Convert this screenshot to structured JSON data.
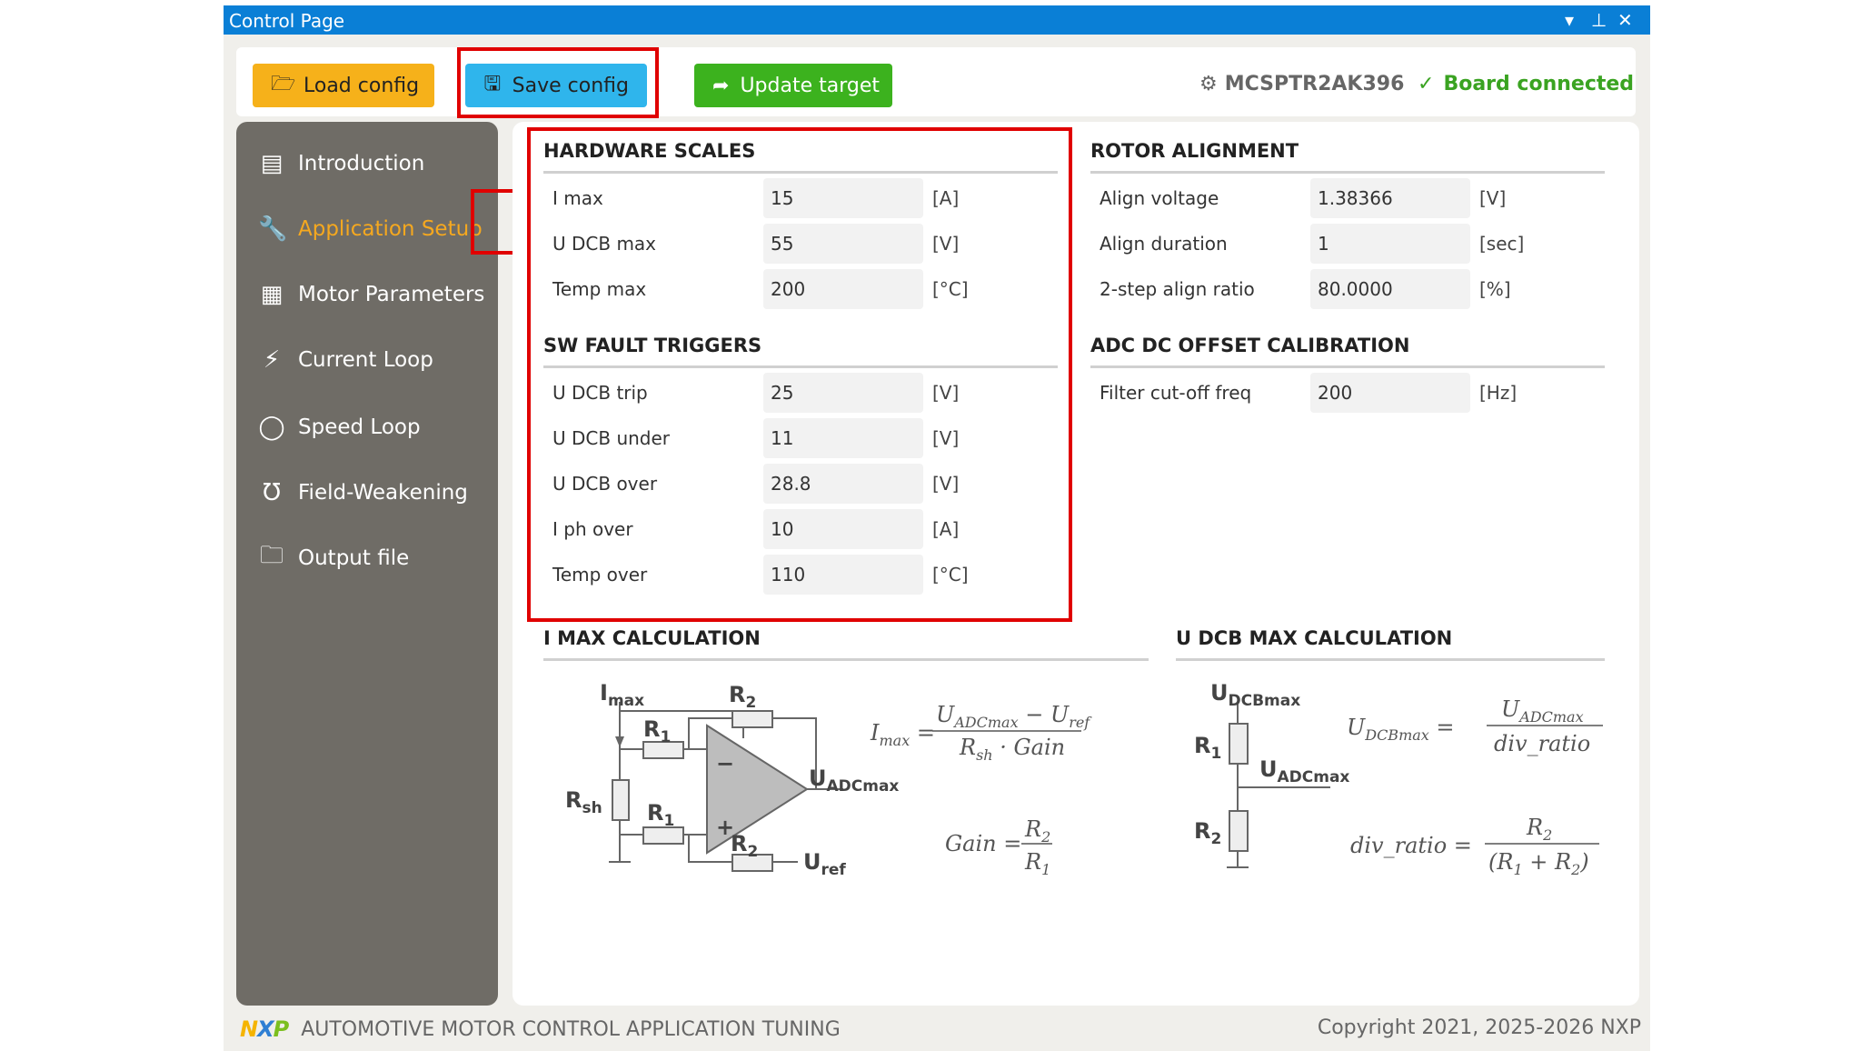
{
  "window": {
    "title": "Control Page",
    "controls": {
      "menu": "▾",
      "pin": "⊥",
      "close": "✕"
    }
  },
  "toolbar": {
    "load_label": "Load config",
    "save_label": "Save config",
    "update_label": "Update target",
    "board_id": "MCSPTR2AK396",
    "board_status": "Board connected",
    "colors": {
      "load": "#f6b11a",
      "save": "#2fb5ec",
      "update": "#3cb21e",
      "status": "#3aa321"
    }
  },
  "sidebar": {
    "items": [
      {
        "label": "Introduction",
        "icon": "book-icon"
      },
      {
        "label": "Application Setup",
        "icon": "wrench-icon",
        "active": true
      },
      {
        "label": "Motor Parameters",
        "icon": "calculator-icon"
      },
      {
        "label": "Current Loop",
        "icon": "lightning-icon"
      },
      {
        "label": "Speed Loop",
        "icon": "circle-icon"
      },
      {
        "label": "Field-Weakening",
        "icon": "magnet-icon"
      },
      {
        "label": "Output file",
        "icon": "folder-icon"
      }
    ],
    "active_color": "#f5a81f"
  },
  "hardware_scales": {
    "title": "HARDWARE SCALES",
    "rows": [
      {
        "label": "I max",
        "value": "15",
        "unit": "[A]"
      },
      {
        "label": "U DCB max",
        "value": "55",
        "unit": "[V]"
      },
      {
        "label": "Temp max",
        "value": "200",
        "unit": "[°C]"
      }
    ]
  },
  "sw_fault_triggers": {
    "title": "SW FAULT TRIGGERS",
    "rows": [
      {
        "label": "U DCB trip",
        "value": "25",
        "unit": "[V]"
      },
      {
        "label": "U DCB under",
        "value": "11",
        "unit": "[V]"
      },
      {
        "label": "U DCB over",
        "value": "28.8",
        "unit": "[V]"
      },
      {
        "label": "I ph over",
        "value": "10",
        "unit": "[A]"
      },
      {
        "label": "Temp over",
        "value": "110",
        "unit": "[°C]"
      }
    ]
  },
  "rotor_alignment": {
    "title": "ROTOR ALIGNMENT",
    "rows": [
      {
        "label": "Align voltage",
        "value": "1.38366",
        "unit": "[V]"
      },
      {
        "label": "Align duration",
        "value": "1",
        "unit": "[sec]"
      },
      {
        "label": "2-step align ratio",
        "value": "80.0000",
        "unit": "[%]"
      }
    ]
  },
  "adc_offset": {
    "title": "ADC DC OFFSET CALIBRATION",
    "rows": [
      {
        "label": "Filter cut-off freq",
        "value": "200",
        "unit": "[Hz]"
      }
    ]
  },
  "imax_calc": {
    "title": "I MAX CALCULATION",
    "labels": {
      "imax": "I",
      "imax_sub": "max",
      "r1": "R",
      "r1_sub": "1",
      "r2": "R",
      "r2_sub": "2",
      "rsh": "R",
      "rsh_sub": "sh",
      "uadc": "U",
      "uadc_sub": "ADCmax",
      "uref": "U",
      "uref_sub": "ref",
      "minus": "−",
      "plus": "+"
    },
    "eq1": {
      "lhs": "I",
      "lhs_sub": "max",
      "num": "U",
      "num_sub": "ADCmax",
      "num_op": " − U",
      "num_sub2": "ref",
      "den": "R",
      "den_sub": "sh",
      "den_op": " · Gain"
    },
    "eq2": {
      "lhs": "Gain",
      "num": "R",
      "num_sub": "2",
      "den": "R",
      "den_sub": "1"
    }
  },
  "udcb_calc": {
    "title": "U DCB MAX CALCULATION",
    "labels": {
      "udcb": "U",
      "udcb_sub": "DCBmax",
      "r1": "R",
      "r1_sub": "1",
      "r2": "R",
      "r2_sub": "2",
      "uadc": "U",
      "uadc_sub": "ADCmax"
    },
    "eq1": {
      "lhs": "U",
      "lhs_sub": "DCBmax",
      "num": "U",
      "num_sub": "ADCmax",
      "den": "div_ratio"
    },
    "eq2": {
      "lhs": "div_ratio",
      "num": "R",
      "num_sub": "2",
      "den_open": "(R",
      "den_sub1": "1",
      "den_mid": " + R",
      "den_sub2": "2",
      "den_close": ")"
    }
  },
  "footer": {
    "logo": "NXP",
    "brand": "AUTOMOTIVE MOTOR CONTROL APPLICATION TUNING",
    "copyright": "Copyright 2021, 2025-2026 NXP"
  }
}
